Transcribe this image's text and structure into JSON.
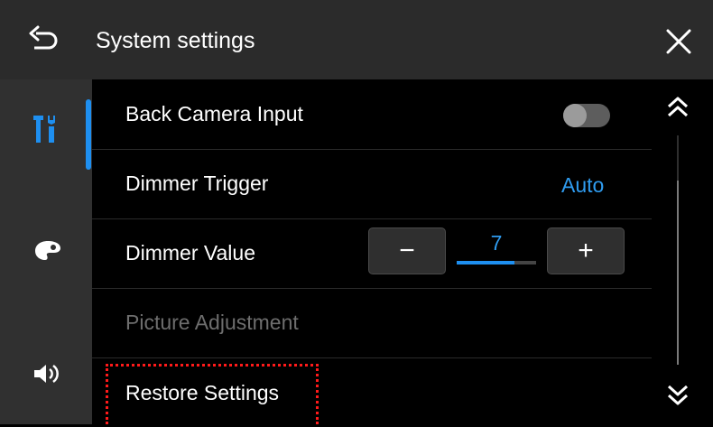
{
  "header": {
    "title": "System settings",
    "back_icon": "back-arrow-icon",
    "close_icon": "close-icon"
  },
  "sidebar": {
    "tabs": [
      {
        "icon": "tools-icon",
        "active": true
      },
      {
        "icon": "palette-icon",
        "active": false
      },
      {
        "icon": "volume-icon",
        "active": false
      }
    ],
    "accent_color": "#1e8ff0"
  },
  "settings": {
    "back_camera_input": {
      "label": "Back Camera Input",
      "enabled": false
    },
    "dimmer_trigger": {
      "label": "Dimmer Trigger",
      "value": "Auto"
    },
    "dimmer_value": {
      "label": "Dimmer Value",
      "value": "7",
      "minus": "−",
      "plus": "+",
      "level": 0.73
    },
    "picture_adjustment": {
      "label": "Picture Adjustment",
      "disabled": true
    },
    "restore_settings": {
      "label": "Restore Settings"
    }
  },
  "scrollbar": {
    "up_icon": "double-chevron-up-icon",
    "down_icon": "double-chevron-down-icon"
  },
  "colors": {
    "accent": "#2f9cf0",
    "focus_outline": "#ff1a1a"
  }
}
